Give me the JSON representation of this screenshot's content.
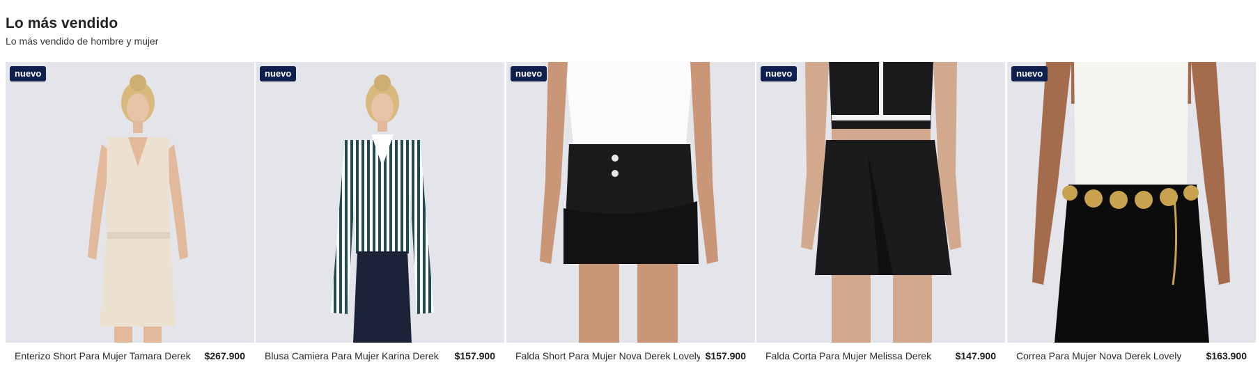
{
  "section": {
    "title": "Lo más vendido",
    "subtitle": "Lo más vendido de hombre y mujer"
  },
  "products": [
    {
      "badge": "nuevo",
      "name": "Enterizo Short Para Mujer Tamara Derek",
      "price": "$267.900"
    },
    {
      "badge": "nuevo",
      "name": "Blusa Camiera Para Mujer Karina Derek",
      "price": "$157.900"
    },
    {
      "badge": "nuevo",
      "name": "Falda Short Para Mujer Nova Derek Lovely",
      "price": "$157.900"
    },
    {
      "badge": "nuevo",
      "name": "Falda Corta Para Mujer Melissa Derek",
      "price": "$147.900"
    },
    {
      "badge": "nuevo",
      "name": "Correa Para Mujer Nova Derek Lovely",
      "price": "$163.900"
    }
  ]
}
